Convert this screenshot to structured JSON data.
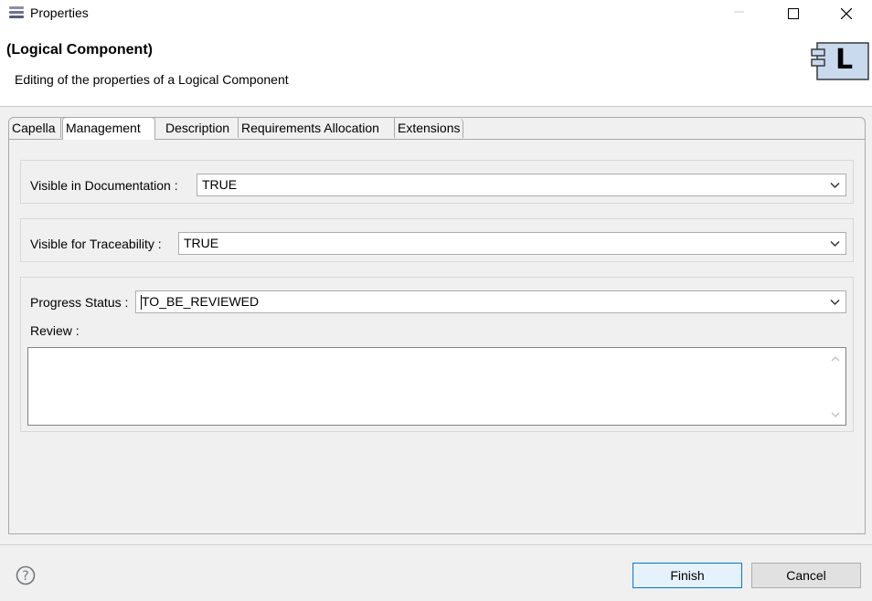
{
  "window": {
    "title": "Properties",
    "app_icon": "stack-icon",
    "controls": [
      "minimize-icon",
      "maximize-icon",
      "close-icon"
    ]
  },
  "header": {
    "title": "(Logical Component)",
    "description": "Editing of the properties of a Logical Component",
    "component_icon": "logical-component-icon",
    "component_icon_letter": "L"
  },
  "tabs": [
    {
      "label": "Capella",
      "active": false
    },
    {
      "label": "Management",
      "active": true
    },
    {
      "label": "Description",
      "active": false
    },
    {
      "label": "Requirements Allocation",
      "active": false
    },
    {
      "label": "Extensions",
      "active": false
    }
  ],
  "management": {
    "visible_in_documentation": {
      "label": "Visible in Documentation :",
      "value": "TRUE"
    },
    "visible_for_traceability": {
      "label": "Visible for Traceability :",
      "value": "TRUE"
    },
    "progress_status": {
      "label": "Progress Status :",
      "value": "TO_BE_REVIEWED"
    },
    "review": {
      "label": "Review :",
      "value": ""
    }
  },
  "footer": {
    "help_icon": "help-icon",
    "finish_label": "Finish",
    "cancel_label": "Cancel"
  },
  "colors": {
    "accent": "#0078d7",
    "background": "#f0f0f0"
  }
}
